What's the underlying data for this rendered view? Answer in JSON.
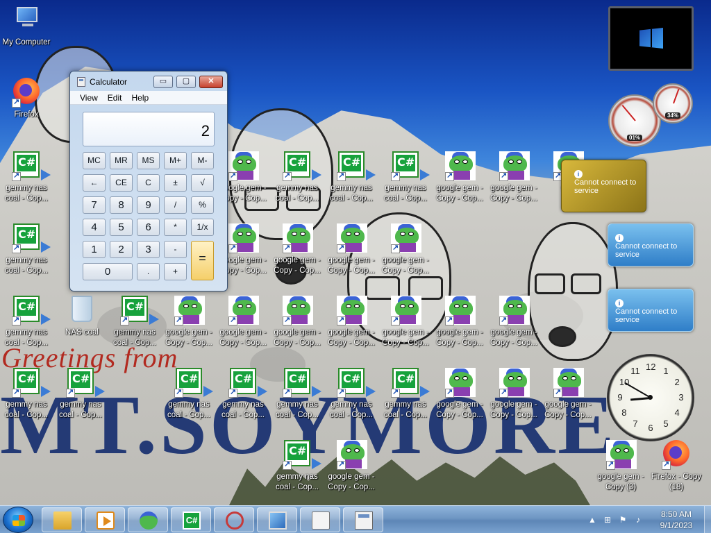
{
  "desktop": {
    "wallpaper_text": {
      "greetings": "Greetings from",
      "place": "MT.SOYMORE"
    },
    "icons": {
      "my_computer": "My Computer",
      "firefox": "Firefox",
      "nas_coal": "NAS coal",
      "gemmy": "gemmy nas coal - Cop...",
      "gemmy_short": "gemmy nas coal - Cop...",
      "google_gem": "google gem - Copy - Cop...",
      "google_gem_3": "google gem - Copy (3)",
      "firefox_copy_18": "Firefox - Copy (18)",
      "gemmy_copy_partial": "gemmy nas coal - Cop...",
      "partial_g": "g",
      "partial_go": "go",
      "partial_ge": "ge",
      "partial_goo": "goo"
    }
  },
  "calculator": {
    "title": "Calculator",
    "menu": [
      "View",
      "Edit",
      "Help"
    ],
    "display_value": "2",
    "caption_buttons": {
      "minimize": "▭",
      "maximize": "▢",
      "close": "✕"
    },
    "rows": [
      [
        "MC",
        "MR",
        "MS",
        "M+",
        "M-"
      ],
      [
        "←",
        "CE",
        "C",
        "±",
        "√"
      ],
      [
        "7",
        "8",
        "9",
        "/",
        "%"
      ],
      [
        "4",
        "5",
        "6",
        "*",
        "1/x"
      ],
      [
        "1",
        "2",
        "3",
        "-",
        "="
      ],
      [
        "0",
        ".",
        "+"
      ]
    ]
  },
  "gadgets": {
    "cpu_meter": {
      "cpu_percent": "01%",
      "memory_percent": "34%",
      "cpu_value": 0.01,
      "memory_value": 0.34
    },
    "weather": [
      {
        "message": "Cannot connect to service"
      },
      {
        "message": "Cannot connect to service"
      },
      {
        "message": "Cannot connect to service"
      }
    ],
    "clock": {
      "numerals": [
        "12",
        "1",
        "2",
        "3",
        "4",
        "5",
        "6",
        "7",
        "8",
        "9",
        "10",
        "11"
      ],
      "hour": 8,
      "minute": 50
    }
  },
  "taskbar": {
    "tray": {
      "time": "8:50 AM",
      "date": "9/1/2023"
    },
    "pinned": [
      "explorer",
      "media-player",
      "google-gem",
      "csharp",
      "snipping-tool",
      "screen",
      "on-screen-keyboard",
      "calculator"
    ]
  },
  "colors": {
    "accent": "#1a6fcf",
    "wallpaper_red": "#b22a20",
    "wallpaper_blue": "#172f70"
  }
}
